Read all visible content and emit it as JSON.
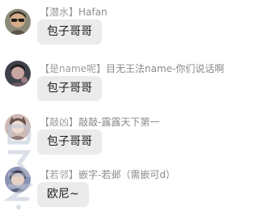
{
  "messages": [
    {
      "tag": "【潜水】",
      "name": "Hafan",
      "text": "包子哥哥",
      "avatar": "avatar-sunglasses-icon",
      "avatar_colors": [
        "#6b6a5e",
        "#d8b08e",
        "#3a2e25"
      ]
    },
    {
      "tag": "【是name呢】",
      "name": "目无王法name-你们说话啊",
      "text": "包子哥哥",
      "avatar": "avatar-dark-icon",
      "avatar_colors": [
        "#4a4d55",
        "#c9a7a0",
        "#2a2525"
      ]
    },
    {
      "tag": "【敲凶】",
      "name": "敲敲-露露天下第一",
      "text": "包子哥哥",
      "avatar": "avatar-anime-icon",
      "avatar_colors": [
        "#b9a2a0",
        "#e9d3c7",
        "#6a5450"
      ]
    },
    {
      "tag": "【若邻】",
      "name": "嵌字-若邺（需嵌可d）",
      "text": "欧尼~",
      "avatar": "avatar-anime-2-icon",
      "avatar_colors": [
        "#7c86a8",
        "#e2ccc0",
        "#3d3748"
      ]
    }
  ],
  "colors": {
    "background": "#ffffff",
    "bubble": "#ebebeb",
    "sender_text": "#8a8a8a",
    "message_text": "#1b1b1b"
  }
}
